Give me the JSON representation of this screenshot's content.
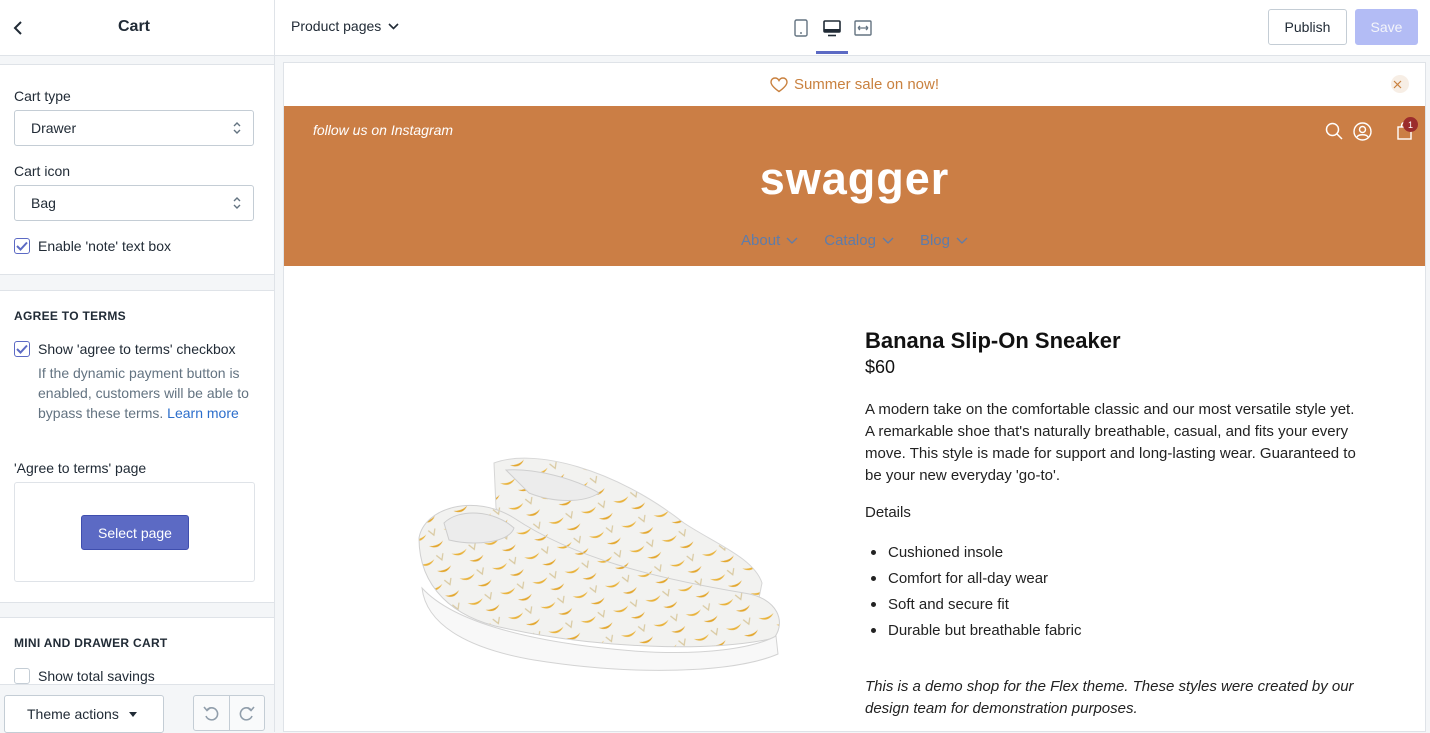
{
  "sidebar": {
    "title": "Cart",
    "cart_type": {
      "label": "Cart type",
      "value": "Drawer"
    },
    "cart_icon": {
      "label": "Cart icon",
      "value": "Bag"
    },
    "enable_note": {
      "label": "Enable 'note' text box",
      "checked": true
    },
    "agree_terms": {
      "heading": "AGREE TO TERMS",
      "checkbox_label": "Show 'agree to terms' checkbox",
      "checked": true,
      "help_text": "If the dynamic payment button is enabled, customers will be able to bypass these terms.",
      "help_link": "Learn more",
      "page_label": "'Agree to terms' page",
      "select_button": "Select page"
    },
    "mini_cart": {
      "heading": "MINI AND DRAWER CART",
      "show_savings_label": "Show total savings",
      "checked": false
    },
    "footer": {
      "theme_actions": "Theme actions"
    }
  },
  "topbar": {
    "page_selector": "Product pages",
    "publish": "Publish",
    "save": "Save",
    "active_view": "desktop"
  },
  "preview": {
    "announcement": "Summer sale on now!",
    "instagram": "follow us on Instagram",
    "logo": "swagger",
    "cart_count": "1",
    "nav": [
      "About",
      "Catalog",
      "Blog"
    ],
    "product": {
      "title": "Banana Slip-On Sneaker",
      "price": "$60",
      "description": "A modern take on the comfortable classic and our most versatile style yet. A remarkable shoe that's naturally breathable, casual, and fits your every move. This style is made for support and long-lasting wear. Guaranteed to be your new everyday 'go-to'.",
      "details_heading": "Details",
      "details": [
        "Cushioned insole",
        "Comfort for all-day wear",
        "Soft and secure fit",
        "Durable but breathable fabric"
      ],
      "note": "This is a demo shop for the Flex theme. These styles were created by our design team for demonstration purposes."
    }
  },
  "colors": {
    "header_bg": "#cb7e45",
    "accent": "#5c6ac4",
    "announcement_text": "#c9813f",
    "nav_text": "#5e7caa"
  }
}
